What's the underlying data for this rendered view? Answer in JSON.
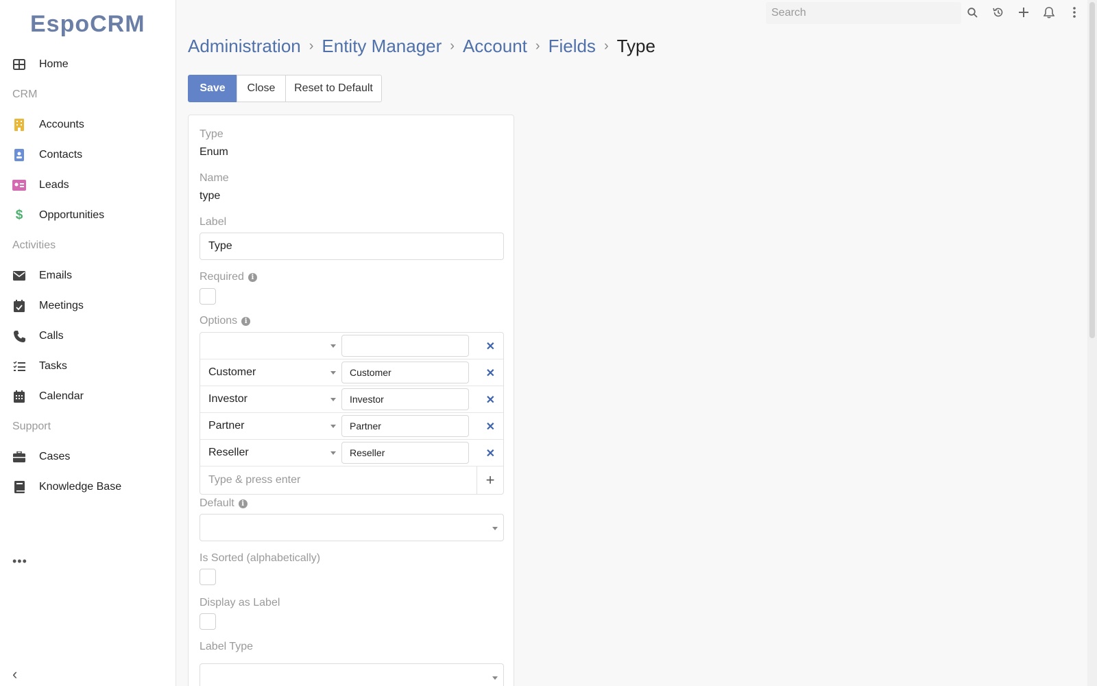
{
  "app": {
    "logo_text": "EspoCRM"
  },
  "search": {
    "placeholder": "Search"
  },
  "topbar": {
    "icons": [
      "search-icon",
      "history-icon",
      "plus-icon",
      "bell-icon",
      "kebab-menu-icon"
    ]
  },
  "sidebar": {
    "home": "Home",
    "group_crm": "CRM",
    "accounts": "Accounts",
    "contacts": "Contacts",
    "leads": "Leads",
    "opportunities": "Opportunities",
    "group_activities": "Activities",
    "emails": "Emails",
    "meetings": "Meetings",
    "calls": "Calls",
    "tasks": "Tasks",
    "calendar": "Calendar",
    "group_support": "Support",
    "cases": "Cases",
    "knowledge_base": "Knowledge Base",
    "more": "•••",
    "collapse": "‹"
  },
  "colors": {
    "accent": "#6383c8",
    "link": "#4f70a9",
    "accounts": "#e8b93a",
    "contacts": "#6b8fd6",
    "leads": "#d46bb0",
    "opportunities": "#4caf6e"
  },
  "breadcrumb": {
    "items": [
      "Administration",
      "Entity Manager",
      "Account",
      "Fields"
    ],
    "current": "Type",
    "separator": "›"
  },
  "buttons": {
    "save": "Save",
    "close": "Close",
    "reset": "Reset to Default"
  },
  "form": {
    "type_label": "Type",
    "type_value": "Enum",
    "name_label": "Name",
    "name_value": "type",
    "label_label": "Label",
    "label_value": "Type",
    "required_label": "Required",
    "options_label": "Options",
    "options": [
      {
        "select": "",
        "text": ""
      },
      {
        "select": "Customer",
        "text": "Customer"
      },
      {
        "select": "Investor",
        "text": "Investor"
      },
      {
        "select": "Partner",
        "text": "Partner"
      },
      {
        "select": "Reseller",
        "text": "Reseller"
      }
    ],
    "add_option_placeholder": "Type & press enter",
    "default_label": "Default",
    "sorted_label": "Is Sorted (alphabetically)",
    "display_as_label": "Display as Label",
    "label_type_label": "Label Type"
  }
}
